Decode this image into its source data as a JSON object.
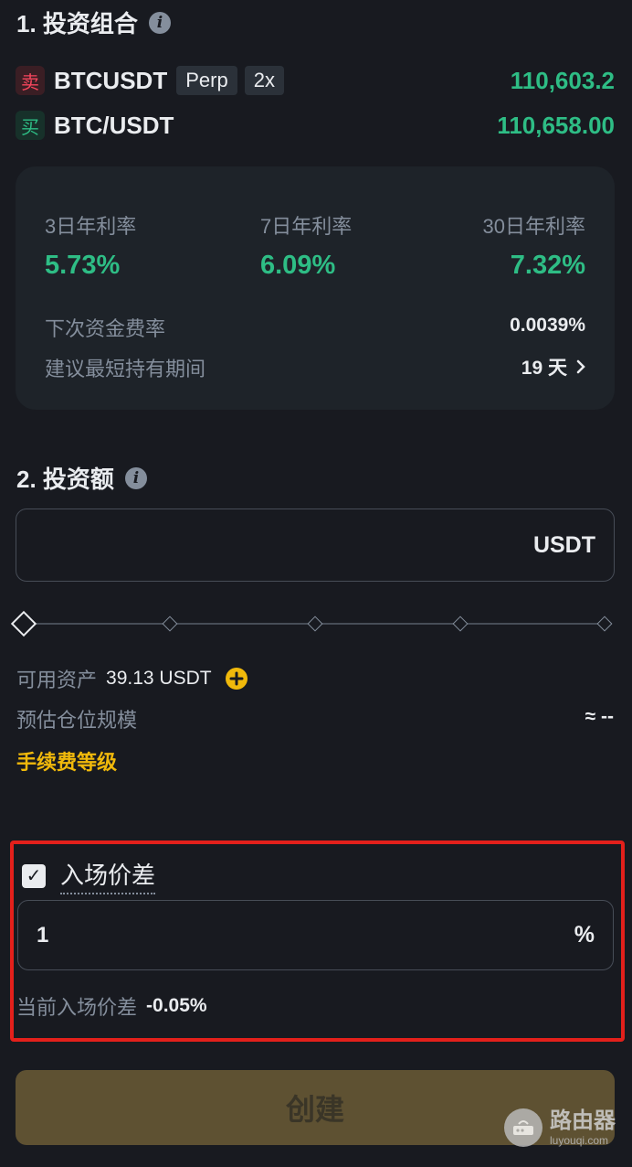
{
  "section1": {
    "title": "1. 投资组合",
    "info_icon": "info-icon"
  },
  "pairs": [
    {
      "side": "卖",
      "side_color": "#f6465d",
      "name": "BTCUSDT",
      "tags": [
        "Perp",
        "2x"
      ],
      "price": "110,603.2"
    },
    {
      "side": "买",
      "side_color": "#2ebd85",
      "name": "BTC/USDT",
      "tags": [],
      "price": "110,658.00"
    }
  ],
  "rates": [
    {
      "label": "3日年利率",
      "value": "5.73%"
    },
    {
      "label": "7日年利率",
      "value": "6.09%"
    },
    {
      "label": "30日年利率",
      "value": "7.32%"
    }
  ],
  "funding": {
    "next_label": "下次资金费率",
    "next_value": "0.0039%",
    "hold_label": "建议最短持有期间",
    "hold_value": "19 天",
    "hold_icon": "chevron-right-icon"
  },
  "section2": {
    "title": "2. 投资额",
    "info_icon": "info-icon"
  },
  "amount_input": {
    "value": "",
    "unit": "USDT"
  },
  "slider": {
    "value_percent": 0
  },
  "available": {
    "label": "可用资产",
    "value": "39.13 USDT",
    "add_icon": "plus-circle-icon"
  },
  "position": {
    "label": "预估仓位规模",
    "value": "≈ --"
  },
  "fee_level": {
    "label": "手续费等级"
  },
  "entry_spread": {
    "checked": true,
    "label": "入场价差",
    "input_value": "1",
    "unit": "%",
    "current_label": "当前入场价差",
    "current_value": "-0.05%"
  },
  "create_button": {
    "label": "创建"
  },
  "watermark": {
    "name": "路由器",
    "url": "luyouqi.com"
  },
  "colors": {
    "background": "#181a20",
    "green": "#2ebd85",
    "red": "#f6465d",
    "yellow": "#f0b90b",
    "highlight": "#e3201b"
  }
}
